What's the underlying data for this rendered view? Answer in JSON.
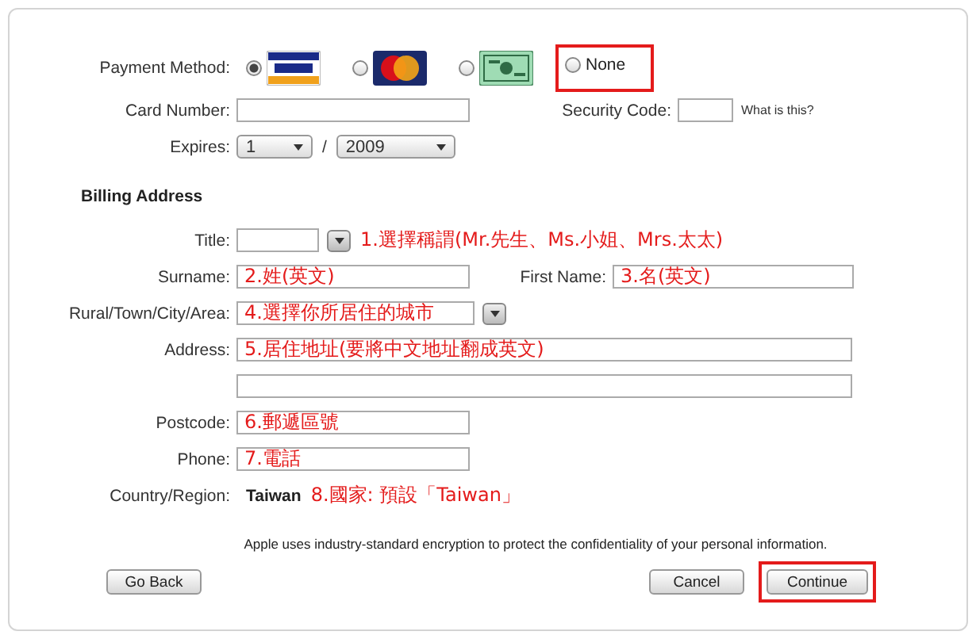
{
  "payment": {
    "label": "Payment Method:",
    "options": [
      {
        "kind": "visa",
        "selected": true,
        "highlighted": false
      },
      {
        "kind": "mastercard",
        "selected": false,
        "highlighted": false
      },
      {
        "kind": "amex",
        "selected": false,
        "highlighted": false
      },
      {
        "kind": "none",
        "label": "None",
        "selected": false,
        "highlighted": true
      }
    ]
  },
  "card_number": {
    "label": "Card Number:"
  },
  "security_code": {
    "label": "Security Code:",
    "help": "What is this?"
  },
  "expires": {
    "label": "Expires:",
    "month": "1",
    "separator": "/",
    "year": "2009"
  },
  "billing": {
    "heading": "Billing Address",
    "title": {
      "label": "Title:",
      "note": "1.選擇稱謂(Mr.先生、Ms.小姐、Mrs.太太)"
    },
    "surname": {
      "label": "Surname:",
      "value": "2.姓(英文)"
    },
    "first_name": {
      "label": "First Name:",
      "value": "3.名(英文)"
    },
    "city": {
      "label": "Rural/Town/City/Area:",
      "value": "4.選擇你所居住的城市"
    },
    "address": {
      "label": "Address:",
      "value": "5.居住地址(要將中文地址翻成英文)"
    },
    "postcode": {
      "label": "Postcode:",
      "value": "6.郵遞區號"
    },
    "phone": {
      "label": "Phone:",
      "value": "7.電話"
    },
    "country": {
      "label": "Country/Region:",
      "value": "Taiwan",
      "note": "8.國家: 預設「Taiwan」"
    }
  },
  "privacy_note": "Apple uses industry-standard encryption to protect the confidentiality of your personal information.",
  "buttons": [
    {
      "label": "Go Back",
      "highlighted": false
    },
    {
      "label": "Cancel",
      "highlighted": false
    },
    {
      "label": "Continue",
      "highlighted": true
    }
  ]
}
